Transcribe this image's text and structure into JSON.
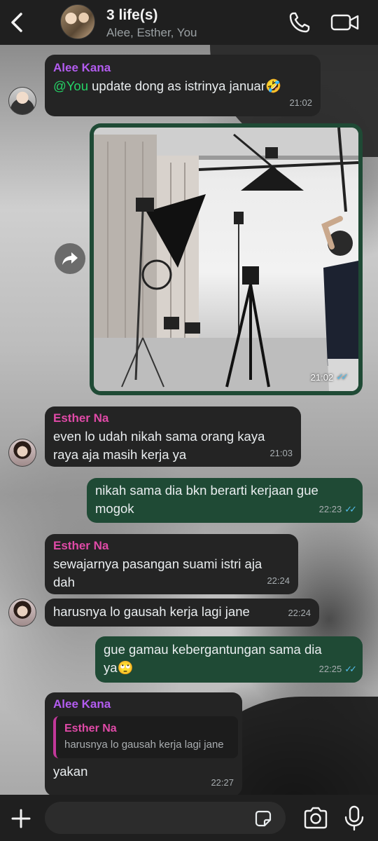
{
  "header": {
    "title": "3 life(s)",
    "members": "Alee, Esther, You"
  },
  "colors": {
    "header_bg": "#1f1f1f",
    "incoming_bubble": "#242424",
    "outgoing_bubble": "#1f4a35",
    "sender_alee": "#b35cf0",
    "sender_esther": "#e04aa7",
    "mention": "#25d366",
    "read_ticks": "#53bdeb"
  },
  "messages": {
    "m1": {
      "sender": "Alee Kana",
      "mention": "@You",
      "text": " update dong as istrinya januar🤣",
      "time": "21:02"
    },
    "m2": {
      "type": "image",
      "time": "21:02",
      "status": "read"
    },
    "m3": {
      "sender": "Esther Na",
      "line1": "even lo udah nikah sama orang kaya",
      "line2": "raya aja masih kerja ya",
      "time": "21:03"
    },
    "m4": {
      "line1": "nikah sama dia bkn berarti kerjaan gue",
      "line2": "mogok",
      "time": "22:23",
      "status": "read"
    },
    "m5": {
      "sender": "Esther Na",
      "line1": "sewajarnya pasangan suami istri aja",
      "line2": "dah",
      "time": "22:24"
    },
    "m6": {
      "text": "harusnya lo gausah kerja lagi jane",
      "time": "22:24"
    },
    "m7": {
      "line1": "gue gamau kebergantungan sama dia",
      "line2": "ya🙄",
      "time": "22:25",
      "status": "read"
    },
    "m8": {
      "sender": "Alee Kana",
      "quote_sender": "Esther Na",
      "quote_text": "harusnya lo gausah kerja lagi jane",
      "text": "yakan",
      "time": "22:27"
    }
  },
  "composer": {
    "value": "",
    "placeholder": ""
  },
  "icons": [
    "back-icon",
    "phone-icon",
    "video-call-icon",
    "forward-icon",
    "plus-icon",
    "sticker-icon",
    "camera-icon",
    "mic-icon"
  ]
}
